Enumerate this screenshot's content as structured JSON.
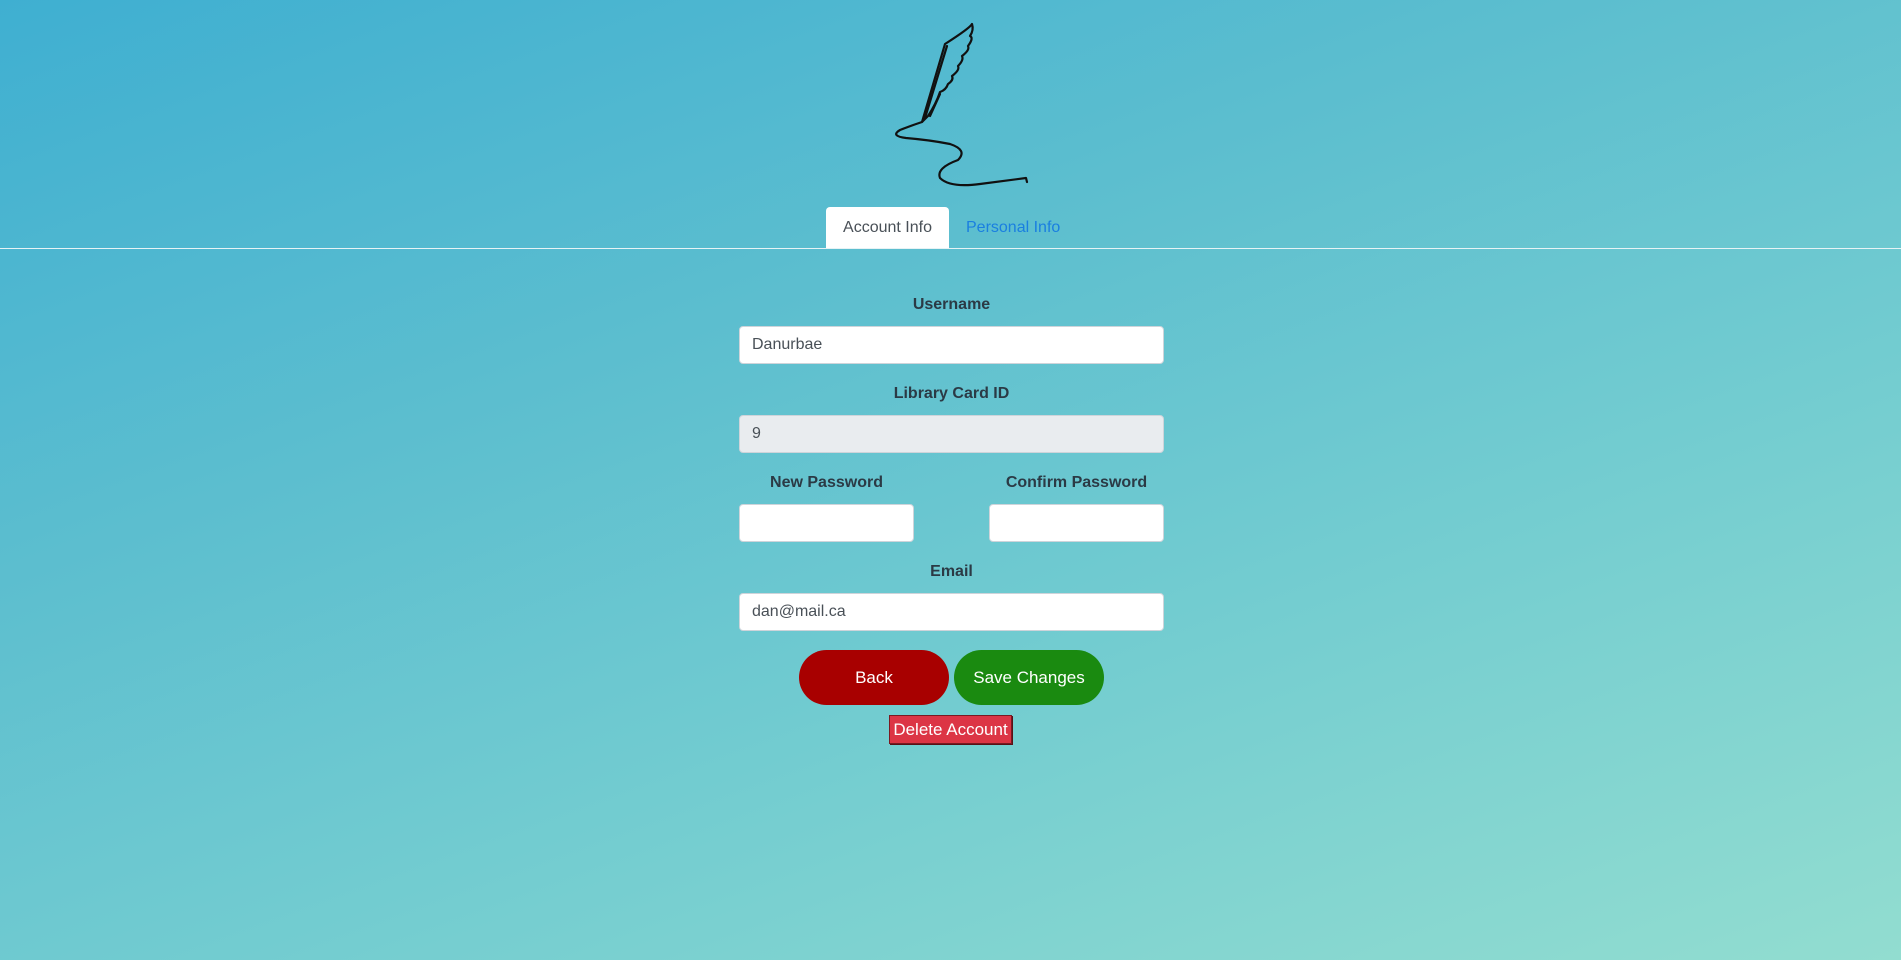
{
  "tabs": [
    {
      "label": "Account Info",
      "active": true
    },
    {
      "label": "Personal Info",
      "active": false
    }
  ],
  "form": {
    "username_label": "Username",
    "username_value": "Danurbae",
    "card_label": "Library Card ID",
    "card_value": "9",
    "new_password_label": "New Password",
    "new_password_value": "",
    "confirm_password_label": "Confirm Password",
    "confirm_password_value": "",
    "email_label": "Email",
    "email_value": "dan@mail.ca"
  },
  "buttons": {
    "back": "Back",
    "save": "Save Changes",
    "delete": "Delete Account"
  },
  "colors": {
    "back": "#a80000",
    "save": "#1a8a10",
    "delete": "#dc3545",
    "tab_link": "#1a7fe0"
  },
  "icons": {
    "logo": "quill-pen-icon"
  }
}
